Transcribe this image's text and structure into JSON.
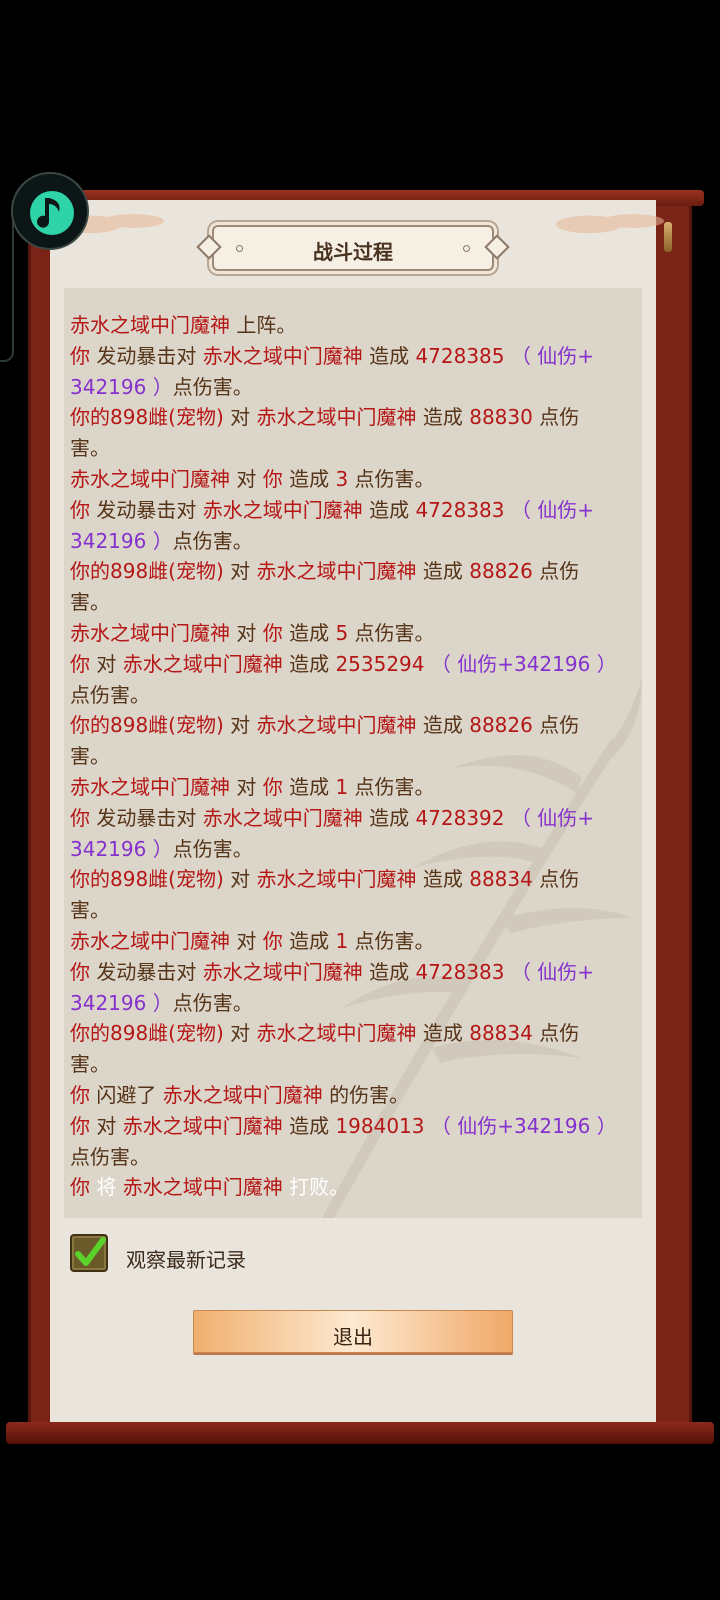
{
  "dialog": {
    "title": "战斗过程",
    "checkbox_label": "观察最新记录",
    "checkbox_checked": true,
    "exit_label": "退出"
  },
  "colors": {
    "red": "#b51717",
    "purple": "#8531ce",
    "brown": "#553418",
    "white": "#ffffff"
  },
  "battle_log": [
    [
      [
        "赤水之域中门魔神",
        "red"
      ],
      [
        " 上阵。",
        "brn"
      ]
    ],
    [
      [
        "你",
        "red"
      ],
      [
        " 发动暴击对 ",
        "brn"
      ],
      [
        "赤水之域中门魔神",
        "red"
      ],
      [
        " 造成 ",
        "brn"
      ],
      [
        "4728385",
        "red"
      ],
      [
        " （ 仙伤+",
        "pur"
      ]
    ],
    [
      [
        "342196 ）",
        "pur"
      ],
      [
        "点伤害。",
        "brn"
      ]
    ],
    [
      [
        "你的898雌(宠物)",
        "red"
      ],
      [
        " 对 ",
        "brn"
      ],
      [
        "赤水之域中门魔神",
        "red"
      ],
      [
        " 造成 ",
        "brn"
      ],
      [
        "88830",
        "red"
      ],
      [
        " 点伤",
        "brn"
      ]
    ],
    [
      [
        "害。",
        "brn"
      ]
    ],
    [
      [
        "赤水之域中门魔神",
        "red"
      ],
      [
        " 对 ",
        "brn"
      ],
      [
        "你",
        "red"
      ],
      [
        " 造成 ",
        "brn"
      ],
      [
        "3",
        "red"
      ],
      [
        " 点伤害。",
        "brn"
      ]
    ],
    [
      [
        "你",
        "red"
      ],
      [
        " 发动暴击对 ",
        "brn"
      ],
      [
        "赤水之域中门魔神",
        "red"
      ],
      [
        " 造成 ",
        "brn"
      ],
      [
        "4728383",
        "red"
      ],
      [
        " （ 仙伤+",
        "pur"
      ]
    ],
    [
      [
        "342196 ）",
        "pur"
      ],
      [
        "点伤害。",
        "brn"
      ]
    ],
    [
      [
        "你的898雌(宠物)",
        "red"
      ],
      [
        " 对 ",
        "brn"
      ],
      [
        "赤水之域中门魔神",
        "red"
      ],
      [
        " 造成 ",
        "brn"
      ],
      [
        "88826",
        "red"
      ],
      [
        " 点伤",
        "brn"
      ]
    ],
    [
      [
        "害。",
        "brn"
      ]
    ],
    [
      [
        "赤水之域中门魔神",
        "red"
      ],
      [
        " 对 ",
        "brn"
      ],
      [
        "你",
        "red"
      ],
      [
        " 造成 ",
        "brn"
      ],
      [
        "5",
        "red"
      ],
      [
        " 点伤害。",
        "brn"
      ]
    ],
    [
      [
        "你",
        "red"
      ],
      [
        " 对 ",
        "brn"
      ],
      [
        "赤水之域中门魔神",
        "red"
      ],
      [
        " 造成 ",
        "brn"
      ],
      [
        "2535294",
        "red"
      ],
      [
        " （ 仙伤+342196 ）",
        "pur"
      ]
    ],
    [
      [
        "点伤害。",
        "brn"
      ]
    ],
    [
      [
        "你的898雌(宠物)",
        "red"
      ],
      [
        " 对 ",
        "brn"
      ],
      [
        "赤水之域中门魔神",
        "red"
      ],
      [
        " 造成 ",
        "brn"
      ],
      [
        "88826",
        "red"
      ],
      [
        " 点伤",
        "brn"
      ]
    ],
    [
      [
        "害。",
        "brn"
      ]
    ],
    [
      [
        "赤水之域中门魔神",
        "red"
      ],
      [
        " 对 ",
        "brn"
      ],
      [
        "你",
        "red"
      ],
      [
        " 造成 ",
        "brn"
      ],
      [
        "1",
        "red"
      ],
      [
        " 点伤害。",
        "brn"
      ]
    ],
    [
      [
        "你",
        "red"
      ],
      [
        " 发动暴击对 ",
        "brn"
      ],
      [
        "赤水之域中门魔神",
        "red"
      ],
      [
        " 造成 ",
        "brn"
      ],
      [
        "4728392",
        "red"
      ],
      [
        " （ 仙伤+",
        "pur"
      ]
    ],
    [
      [
        "342196 ）",
        "pur"
      ],
      [
        "点伤害。",
        "brn"
      ]
    ],
    [
      [
        "你的898雌(宠物)",
        "red"
      ],
      [
        " 对 ",
        "brn"
      ],
      [
        "赤水之域中门魔神",
        "red"
      ],
      [
        " 造成 ",
        "brn"
      ],
      [
        "88834",
        "red"
      ],
      [
        " 点伤",
        "brn"
      ]
    ],
    [
      [
        "害。",
        "brn"
      ]
    ],
    [
      [
        "赤水之域中门魔神",
        "red"
      ],
      [
        " 对 ",
        "brn"
      ],
      [
        "你",
        "red"
      ],
      [
        " 造成 ",
        "brn"
      ],
      [
        "1",
        "red"
      ],
      [
        " 点伤害。",
        "brn"
      ]
    ],
    [
      [
        "你",
        "red"
      ],
      [
        " 发动暴击对 ",
        "brn"
      ],
      [
        "赤水之域中门魔神",
        "red"
      ],
      [
        " 造成 ",
        "brn"
      ],
      [
        "4728383",
        "red"
      ],
      [
        " （ 仙伤+",
        "pur"
      ]
    ],
    [
      [
        "342196 ）",
        "pur"
      ],
      [
        "点伤害。",
        "brn"
      ]
    ],
    [
      [
        "你的898雌(宠物)",
        "red"
      ],
      [
        " 对 ",
        "brn"
      ],
      [
        "赤水之域中门魔神",
        "red"
      ],
      [
        " 造成 ",
        "brn"
      ],
      [
        "88834",
        "red"
      ],
      [
        " 点伤",
        "brn"
      ]
    ],
    [
      [
        "害。",
        "brn"
      ]
    ],
    [
      [
        "你",
        "red"
      ],
      [
        " 闪避了 ",
        "brn"
      ],
      [
        "赤水之域中门魔神",
        "red"
      ],
      [
        " 的伤害。",
        "brn"
      ]
    ],
    [
      [
        "你",
        "red"
      ],
      [
        " 对 ",
        "brn"
      ],
      [
        "赤水之域中门魔神",
        "red"
      ],
      [
        " 造成 ",
        "brn"
      ],
      [
        "1984013",
        "red"
      ],
      [
        " （ 仙伤+342196 ）",
        "pur"
      ]
    ],
    [
      [
        "点伤害。",
        "brn"
      ]
    ],
    [
      [
        "你",
        "red"
      ],
      [
        " 将 ",
        "wht"
      ],
      [
        "赤水之域中门魔神",
        "red"
      ],
      [
        " 打败。",
        "wht"
      ]
    ]
  ]
}
